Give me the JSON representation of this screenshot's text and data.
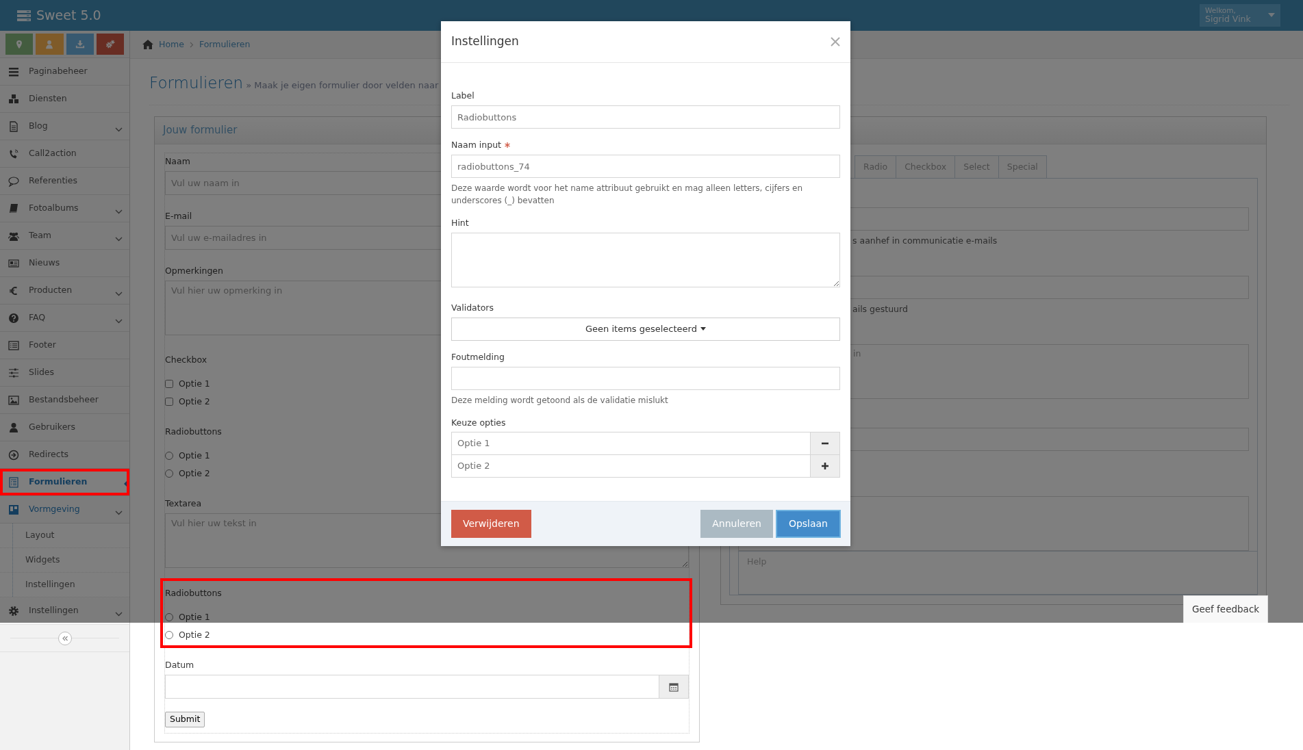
{
  "app": {
    "title": "Sweet 5.0",
    "welcome": "Welkom,",
    "user": "Sigrid Vink"
  },
  "shortcuts": [
    {
      "kind": "location"
    },
    {
      "kind": "user"
    },
    {
      "kind": "download"
    },
    {
      "kind": "settings"
    }
  ],
  "sidebar": {
    "items": [
      {
        "label": "Paginabeheer",
        "expandable": false,
        "selected": false,
        "highlighted": false
      },
      {
        "label": "Diensten",
        "expandable": false,
        "selected": false,
        "highlighted": false
      },
      {
        "label": "Blog",
        "expandable": true,
        "selected": false,
        "highlighted": false
      },
      {
        "label": "Call2action",
        "expandable": false,
        "selected": false,
        "highlighted": false
      },
      {
        "label": "Referenties",
        "expandable": false,
        "selected": false,
        "highlighted": false
      },
      {
        "label": "Fotoalbums",
        "expandable": true,
        "selected": false,
        "highlighted": false
      },
      {
        "label": "Team",
        "expandable": true,
        "selected": false,
        "highlighted": false
      },
      {
        "label": "Nieuws",
        "expandable": false,
        "selected": false,
        "highlighted": false
      },
      {
        "label": "Producten",
        "expandable": true,
        "selected": false,
        "highlighted": false
      },
      {
        "label": "FAQ",
        "expandable": true,
        "selected": false,
        "highlighted": false
      },
      {
        "label": "Footer",
        "expandable": false,
        "selected": false,
        "highlighted": false
      },
      {
        "label": "Slides",
        "expandable": false,
        "selected": false,
        "highlighted": false
      },
      {
        "label": "Bestandsbeheer",
        "expandable": false,
        "selected": false,
        "highlighted": false
      },
      {
        "label": "Gebruikers",
        "expandable": false,
        "selected": false,
        "highlighted": false
      },
      {
        "label": "Redirects",
        "expandable": false,
        "selected": false,
        "highlighted": false
      },
      {
        "label": "Formulieren",
        "expandable": false,
        "selected": true,
        "highlighted": true
      },
      {
        "label": "Vormgeving",
        "expandable": true,
        "expanded": true,
        "selected": false,
        "highlighted": false,
        "children": [
          {
            "label": "Layout",
            "selected": false
          },
          {
            "label": "Widgets",
            "selected": false
          },
          {
            "label": "Instellingen",
            "selected": false
          }
        ]
      },
      {
        "label": "Instellingen",
        "expandable": true,
        "selected": false,
        "highlighted": false
      }
    ]
  },
  "breadcrumb": [
    "Home",
    "Formulieren"
  ],
  "page_header": {
    "title": "Formulieren",
    "subtitle": "» Maak je eigen formulier door velden naar"
  },
  "form_preview": {
    "title": "Jouw formulier",
    "fields": [
      {
        "kind": "text",
        "label": "Naam",
        "placeholder": "Vul uw naam in",
        "highlighted": false
      },
      {
        "kind": "text",
        "label": "E-mail",
        "placeholder": "Vul uw e-mailadres in",
        "highlighted": false
      },
      {
        "kind": "textarea",
        "label": "Opmerkingen",
        "placeholder": "Vul hier uw opmerking in",
        "highlighted": false
      },
      {
        "kind": "checkbox",
        "label": "Checkbox",
        "highlighted": false,
        "options": [
          {
            "label": "Optie 1",
            "checked": false
          },
          {
            "label": "Optie 2",
            "checked": false
          }
        ]
      },
      {
        "kind": "radio",
        "label": "Radiobuttons",
        "highlighted": false,
        "options": [
          {
            "label": "Optie 1",
            "selected": false
          },
          {
            "label": "Optie 2",
            "selected": false
          }
        ]
      },
      {
        "kind": "textarea",
        "label": "Textarea",
        "placeholder": "Vul hier uw tekst in",
        "highlighted": false
      },
      {
        "kind": "radio",
        "label": "Radiobuttons",
        "highlighted": true,
        "options": [
          {
            "label": "Optie 1",
            "selected": false
          },
          {
            "label": "Optie 2",
            "selected": false
          }
        ]
      },
      {
        "kind": "date",
        "label": "Datum",
        "highlighted": false
      }
    ],
    "submit": "Submit"
  },
  "field_palette": {
    "tabs": [
      {
        "label": "Radio",
        "selected": false
      },
      {
        "label": "Checkbox",
        "selected": false
      },
      {
        "label": "Select",
        "selected": false
      },
      {
        "label": "Special",
        "selected": false
      }
    ],
    "hints": [
      "s aanhef in communicatie e-mails",
      "ails gestuurd"
    ],
    "textarea_placeholder": "in",
    "help_label": "Help"
  },
  "dialog": {
    "title": "Instellingen",
    "fields": [
      {
        "kind": "text",
        "label": "Label",
        "value": "Radiobuttons",
        "required": false
      },
      {
        "kind": "text",
        "label": "Naam input",
        "value": "radiobuttons_74",
        "required": true,
        "help": "Deze waarde wordt voor het name attribuut gebruikt en mag alleen letters, cijfers en underscores (_) bevatten"
      },
      {
        "kind": "textarea",
        "label": "Hint",
        "required": false
      },
      {
        "kind": "dropdown",
        "label": "Validators",
        "value": "Geen items geselecteerd",
        "required": false
      },
      {
        "kind": "text",
        "label": "Foutmelding",
        "required": false,
        "help": "Deze melding wordt getoond als de validatie mislukt"
      },
      {
        "kind": "options",
        "label": "Keuze opties",
        "required": false,
        "options": [
          "Optie 1",
          "Optie 2"
        ]
      }
    ],
    "buttons": [
      {
        "label": "Verwijderen",
        "kind": "danger"
      },
      {
        "label": "Annuleren",
        "kind": "secondary"
      },
      {
        "label": "Opslaan",
        "kind": "primary"
      }
    ]
  },
  "feedback_button": "Geef feedback"
}
